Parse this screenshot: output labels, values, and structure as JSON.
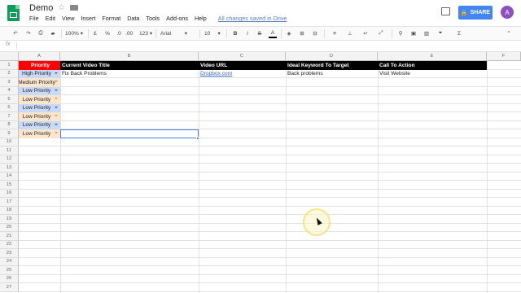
{
  "app": {
    "doc_title": "Demo",
    "menu": [
      "File",
      "Edit",
      "View",
      "Insert",
      "Format",
      "Data",
      "Tools",
      "Add-ons",
      "Help"
    ],
    "saved_status": "All changes saved in Drive",
    "share_label": "SHARE",
    "avatar_initial": "A"
  },
  "toolbar": {
    "zoom": "100%",
    "currency": "£",
    "percent": "%",
    "decimal_less": ".0",
    "decimal_more": ".00",
    "number_format": "123",
    "font": "Arial",
    "font_size": "10",
    "bold": "B",
    "italic": "I",
    "strike": "S",
    "text_color": "A",
    "sum": "Σ"
  },
  "formula_bar": {
    "fx": "fx",
    "content": ""
  },
  "columns": [
    "A",
    "B",
    "C",
    "D",
    "E",
    "F"
  ],
  "rows": [
    "1",
    "2",
    "3",
    "4",
    "5",
    "6",
    "7",
    "8",
    "9",
    "10",
    "11",
    "12",
    "13",
    "14",
    "15",
    "16",
    "17",
    "18",
    "19",
    "20",
    "21",
    "22",
    "23",
    "24",
    "25",
    "26",
    "27"
  ],
  "header_row": {
    "A": "Priority",
    "B": "Current Video Title",
    "C": "Video URL",
    "D": "Ideal Keyword To Target",
    "E": "Call To Action"
  },
  "priority_cells": [
    {
      "text": "High Priority",
      "bg": "#c9daf8",
      "arrow": "#2b5fb7"
    },
    {
      "text": "Medium Priority",
      "bg": "#fce5cd",
      "arrow": "#e69138"
    },
    {
      "text": "Low Priority",
      "bg": "#c9daf8",
      "arrow": "#2b5fb7"
    },
    {
      "text": "Low Priority",
      "bg": "#fce5cd",
      "arrow": "#e69138"
    },
    {
      "text": "Low Priority",
      "bg": "#c9daf8",
      "arrow": "#2b5fb7"
    },
    {
      "text": "Low Priority",
      "bg": "#fce5cd",
      "arrow": "#e69138"
    },
    {
      "text": "Low Priority",
      "bg": "#c9daf8",
      "arrow": "#2b5fb7"
    },
    {
      "text": "Low Priority",
      "bg": "#fce5cd",
      "arrow": "#e69138"
    }
  ],
  "row2": {
    "B": "Fix Back Problems",
    "C": "Dropbox.com",
    "D": "Back problems",
    "E": "Visit Website"
  },
  "colors": {
    "priority_header": "#ff0000",
    "header_bg": "#000000",
    "share": "#4285f4",
    "selection": "#4a7de8"
  }
}
